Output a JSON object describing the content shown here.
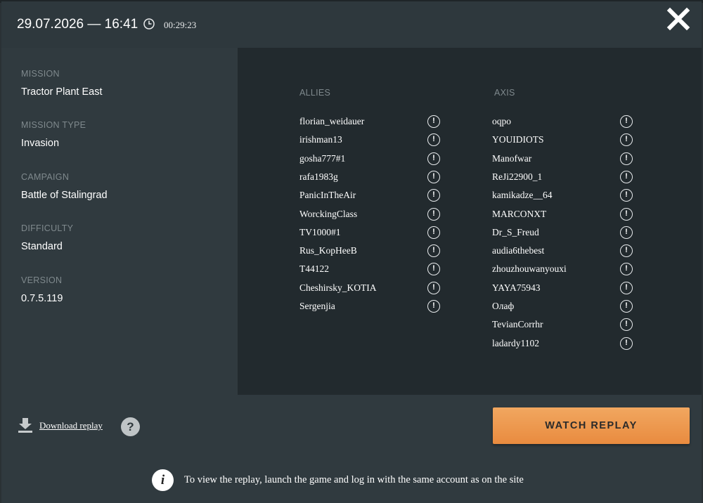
{
  "header": {
    "datetime": "29.07.2026 — 16:41",
    "duration": "00:29:23",
    "clock_icon": "clock-icon",
    "close_icon": "close-icon"
  },
  "info": [
    {
      "label": "MISSION",
      "value": "Tractor Plant East"
    },
    {
      "label": "MISSION TYPE",
      "value": "Invasion"
    },
    {
      "label": "CAMPAIGN",
      "value": "Battle of Stalingrad"
    },
    {
      "label": "DIFFICULTY",
      "value": "Standard"
    },
    {
      "label": "VERSION",
      "value": "0.7.5.119"
    }
  ],
  "teams": {
    "allies": {
      "title": "ALLIES",
      "players": [
        "florian_weidauer",
        "irishman13",
        "gosha777#1",
        "rafa1983g",
        "PanicInTheAir",
        "WorckingClass",
        "TV1000#1",
        "Rus_KopHeeB",
        "T44122",
        "Cheshirsky_KOTIA",
        "Sergenjia"
      ]
    },
    "axis": {
      "title": "AXIS",
      "players": [
        "oqpo",
        "YOUIDIOTS",
        "Manofwar",
        "ReJi22900_1",
        "kamikadze__64",
        "MARCONXT",
        "Dr_S_Freud",
        "audia6thebest",
        "zhouzhouwanyouxi",
        "YAYA75943",
        "Олаф",
        "TevianCorrhr",
        "ladardy1102"
      ]
    }
  },
  "player_info_glyph": "!",
  "footer": {
    "download_label": "Download replay",
    "help_glyph": "?",
    "watch_label": "WATCH REPLAY",
    "info_glyph": "i",
    "note": "To view the replay, launch the game and log in with the same account as on the site"
  },
  "colors": {
    "background": "#303a3f",
    "players_panel": "#222a2e",
    "accent": "#ed9a4f",
    "muted_label": "#7f898d"
  }
}
